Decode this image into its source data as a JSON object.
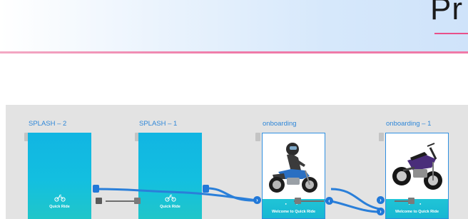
{
  "header": {
    "title": "Pr",
    "accent_color": "#ef7aa8",
    "underline_color": "#e8508a"
  },
  "flow": {
    "canvas_color": "#e3e3e3",
    "wire_color": "#2a7fd9",
    "screens": [
      {
        "label": "SPLASH – 2",
        "type": "splash",
        "logo_text": "Quick Ride",
        "logo_icon": "motorbike-icon"
      },
      {
        "label": "SPLASH – 1",
        "type": "splash",
        "logo_text": "Quick Ride",
        "logo_icon": "motorbike-icon"
      },
      {
        "label": "onboarding",
        "type": "onboarding",
        "illustration": "rider-on-motorcycle",
        "footer_text": "Welcome to Quick Ride"
      },
      {
        "label": "onboarding – 1",
        "type": "onboarding",
        "illustration": "purple-motorcycle",
        "footer_text": "Welcome to Quick Ride"
      }
    ],
    "handle_arrow": "›",
    "handle_back_arrow": "‹"
  }
}
